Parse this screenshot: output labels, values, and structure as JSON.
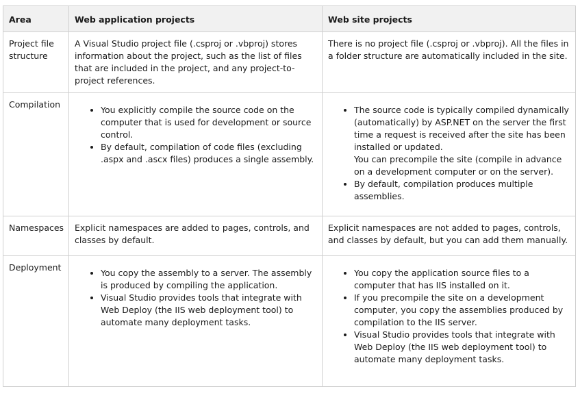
{
  "headers": {
    "area": "Area",
    "web_app": "Web application projects",
    "web_site": "Web site projects"
  },
  "rows": {
    "structure": {
      "area": "Project file structure",
      "web_app": "A Visual Studio project file (.csproj or .vbproj) stores information about the project, such as the list of files that are included in the project, and any project-to-project references.",
      "web_site": "There is no project file (.csproj or .vbproj). All the files in a folder structure are automatically included in the site."
    },
    "compilation": {
      "area": "Compilation",
      "web_app": [
        "You explicitly compile the source code on the computer that is used for development or source control.",
        "By default, compilation of code files (excluding .aspx and .ascx files) produces a single assembly."
      ],
      "web_site_item1_line1": "The source code is typically compiled dynamically (automatically) by ASP.NET on the server the first time a request is received after the site has been installed or updated.",
      "web_site_item1_line2": "You can precompile the site (compile in advance on a development computer or on the server).",
      "web_site_item2": "By default, compilation produces multiple assemblies."
    },
    "namespaces": {
      "area": "Namespaces",
      "web_app": "Explicit namespaces are added to pages, controls, and classes by default.",
      "web_site": "Explicit namespaces are not added to pages, controls, and classes by default, but you can add them manually."
    },
    "deployment": {
      "area": "Deployment",
      "web_app": [
        "You copy the assembly to a server. The assembly is produced by compiling the application.",
        "Visual Studio provides tools that integrate with Web Deploy (the IIS web deployment tool) to automate many deployment tasks."
      ],
      "web_site": [
        "You copy the application source files to a computer that has IIS installed on it.",
        "If you precompile the site on a development computer, you copy the assemblies produced by compilation to the IIS server.",
        "Visual Studio provides tools that integrate with Web Deploy (the IIS web deployment tool) to automate many deployment tasks."
      ]
    }
  }
}
